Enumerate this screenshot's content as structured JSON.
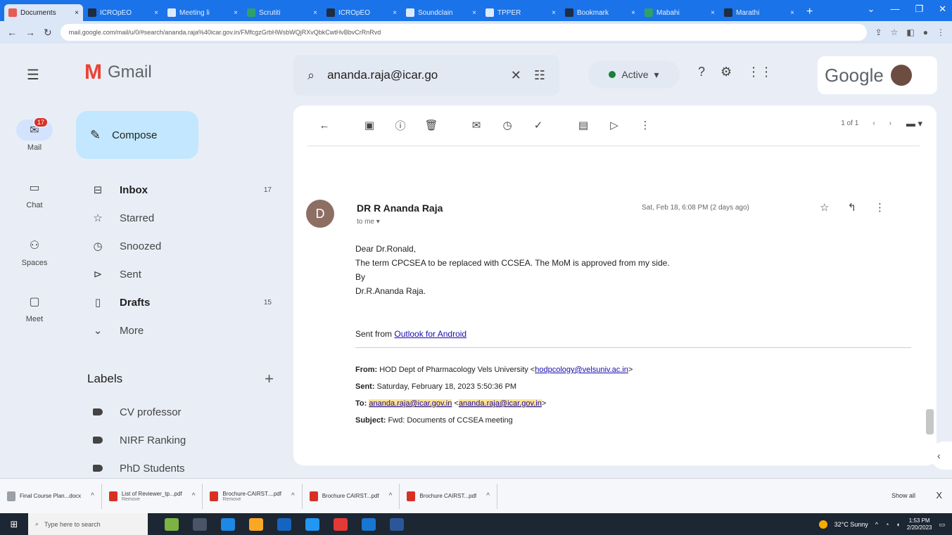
{
  "browser": {
    "tabs": [
      {
        "label": "Documents",
        "active": true
      },
      {
        "label": "ICROpEO",
        "active": false
      },
      {
        "label": "Meeting li",
        "active": false
      },
      {
        "label": "Scrutiti",
        "active": false
      },
      {
        "label": "ICROpEO",
        "active": false
      },
      {
        "label": "Soundclain",
        "active": false
      },
      {
        "label": "TPPER",
        "active": false
      },
      {
        "label": "Bookmark",
        "active": false
      },
      {
        "label": "Mabahi",
        "active": false
      },
      {
        "label": "Marathi",
        "active": false
      }
    ],
    "new_tab": "+",
    "url": "mail.google.com/mail/u/0/#search/ananda.raja%40icar.gov.in/FMfcgzGrbHWsbWQjRXvQbkCwtHvBbvCrRnRvd"
  },
  "gmail": {
    "logo_text": "Gmail",
    "rail": [
      {
        "label": "Mail",
        "badge": "17"
      },
      {
        "label": "Chat"
      },
      {
        "label": "Spaces"
      },
      {
        "label": "Meet"
      }
    ],
    "compose_label": "Compose",
    "nav": [
      {
        "label": "Inbox",
        "count": "17",
        "bold": true
      },
      {
        "label": "Starred",
        "count": ""
      },
      {
        "label": "Snoozed",
        "count": ""
      },
      {
        "label": "Sent",
        "count": ""
      },
      {
        "label": "Drafts",
        "count": "15",
        "bold": true
      },
      {
        "label": "More",
        "count": ""
      }
    ],
    "labels_heading": "Labels",
    "labels_add": "+",
    "labels": [
      "CV professor",
      "NIRF Ranking",
      "PhD Students"
    ],
    "search_value": "ananda.raja@icar.go",
    "status_label": "Active",
    "google_text": "Google",
    "pager_text": "1 of 1"
  },
  "message": {
    "avatar_letter": "D",
    "sender": "DR R Ananda Raja",
    "to_me": "to me",
    "date": "Sat, Feb 18, 6:08 PM (2 days ago)",
    "body_lines": [
      "Dear Dr.Ronald,",
      "The term CPCSEA to be replaced with CCSEA. The MoM is approved from my side.",
      "By",
      "Dr.R.Ananda Raja."
    ],
    "sent_from_prefix": "Sent from ",
    "sent_from_link": "Outlook for Android",
    "fwd": {
      "from_label": "From:",
      "from_value": " HOD Dept of Pharmacology Vels University <",
      "from_email": "hodpcology@velsuniv.ac.in",
      "from_end": ">",
      "sent_label": "Sent:",
      "sent_value": " Saturday, February 18, 2023 5:50:36 PM",
      "to_label": "To:",
      "to_email1": "ananda.raja@icar.gov.in",
      "to_mid": " <",
      "to_email2": "ananda.raja@icar.gov.in",
      "to_end": ">",
      "subject_label": "Subject:",
      "subject_value": " Fwd: Documents of CCSEA meeting"
    }
  },
  "downloads": {
    "items": [
      {
        "name": "Final Course Plan...docx",
        "sub": ""
      },
      {
        "name": "List of Reviewer_tp...pdf",
        "sub": "Remove"
      },
      {
        "name": "Brochure-CAIRST....pdf",
        "sub": "Remove"
      },
      {
        "name": "Brochure CAIRST...pdf",
        "sub": ""
      },
      {
        "name": "Brochure CAIRST...pdf",
        "sub": ""
      }
    ],
    "show_all": "Show all",
    "close": "X"
  },
  "taskbar": {
    "search_placeholder": "Type here to search",
    "weather": "32°C Sunny",
    "time": "1:53 PM",
    "date": "2/20/2023"
  }
}
